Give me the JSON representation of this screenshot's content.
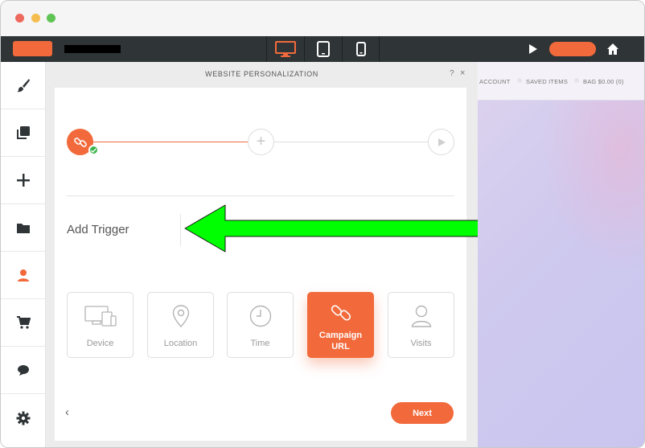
{
  "panel": {
    "title": "WEBSITE PERSONALIZATION",
    "help": "?",
    "close": "×"
  },
  "steps": {
    "add": "+"
  },
  "trigger": {
    "heading": "Add Trigger",
    "options": [
      {
        "label": "Device",
        "icon": "device-icon",
        "selected": false
      },
      {
        "label": "Location",
        "icon": "location-pin-icon",
        "selected": false
      },
      {
        "label": "Time",
        "icon": "clock-icon",
        "selected": false
      },
      {
        "label": "Campaign URL",
        "icon": "link-icon",
        "selected": true
      },
      {
        "label": "Visits",
        "icon": "user-icon",
        "selected": false
      }
    ]
  },
  "footer": {
    "back": "‹",
    "next": "Next"
  },
  "preview": {
    "nav": [
      "ACCOUNT",
      "SAVED ITEMS",
      "BAG $0.00 (0)"
    ]
  },
  "colors": {
    "accent": "#f26a3b",
    "toolbar": "#2f3437",
    "success": "#39b54a",
    "annotation_arrow": "#00ff00"
  }
}
